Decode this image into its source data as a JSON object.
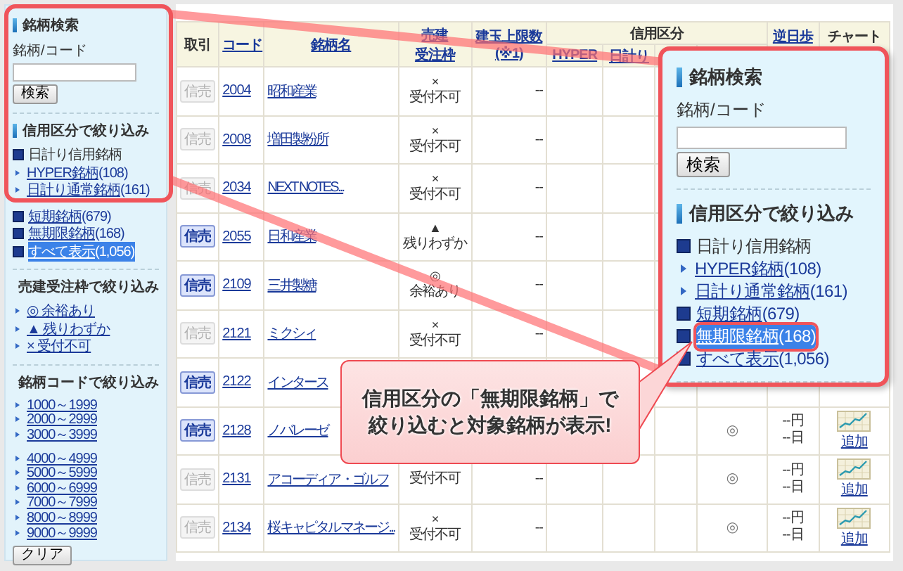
{
  "sidebar": {
    "search": {
      "title": "銘柄検索",
      "label": "銘柄/コード",
      "button": "検索"
    },
    "credit_filter": {
      "title": "信用区分で絞り込み",
      "items": [
        {
          "kind": "group",
          "label": "日計り信用銘柄",
          "children": [
            {
              "kind": "link",
              "label": "HYPER銘柄",
              "count": "(108)",
              "selected": false
            },
            {
              "kind": "link",
              "label": "日計り通常銘柄",
              "count": "(161)",
              "selected": false
            }
          ]
        },
        {
          "kind": "link",
          "label": "短期銘柄",
          "count": "(679)",
          "selected": false
        },
        {
          "kind": "link",
          "label": "無期限銘柄",
          "count": "(168)",
          "selected": false
        },
        {
          "kind": "link",
          "label": "すべて表示",
          "count": "(1,056)",
          "selected": true
        }
      ]
    },
    "margin_filter": {
      "title": "売建受注枠で絞り込み",
      "items": [
        "◎ 余裕あり",
        "▲ 残りわずか",
        "× 受付不可"
      ]
    },
    "code_filter": {
      "title": "銘柄コードで絞り込み",
      "items": [
        "1000～1999",
        "2000～2999",
        "3000～3999",
        "4000～4999",
        "5000～5999",
        "6000～6999",
        "7000～7999",
        "8000～8999",
        "9000～9999"
      ]
    },
    "clear_button": "クリア"
  },
  "table": {
    "header": [
      {
        "lines": [
          "取引"
        ],
        "link": false
      },
      {
        "lines": [
          "コード"
        ],
        "link": true
      },
      {
        "lines": [
          "銘柄名"
        ],
        "link": true
      },
      {
        "lines": [
          "売建",
          "受注枠"
        ],
        "link": true
      },
      {
        "lines": [
          "建玉上限数",
          "(※1)"
        ],
        "link": true
      },
      {
        "group": "信用区分",
        "subs": [
          "HYPER",
          "日計り"
        ]
      },
      {
        "lines": [
          "逆日歩"
        ],
        "link": true
      },
      {
        "lines": [
          "チャート"
        ],
        "link": false
      }
    ],
    "rows": [
      {
        "trade": "信売",
        "enabled": false,
        "code": "2004",
        "name": "昭和産業",
        "mark": "×",
        "status": "受付不可",
        "limit": "--"
      },
      {
        "trade": "信売",
        "enabled": false,
        "code": "2008",
        "name": "増田製粉所",
        "mark": "×",
        "status": "受付不可",
        "limit": "--"
      },
      {
        "trade": "信売",
        "enabled": false,
        "code": "2034",
        "name": "NEXT NOTES...",
        "mark": "×",
        "status": "受付不可",
        "limit": "--"
      },
      {
        "trade": "信売",
        "enabled": true,
        "code": "2055",
        "name": "日和産業",
        "mark": "▲",
        "status": "残りわずか",
        "limit": "--"
      },
      {
        "trade": "信売",
        "enabled": true,
        "code": "2109",
        "name": "三井製糖",
        "mark": "◎",
        "status": "余裕あり",
        "limit": "--"
      },
      {
        "trade": "信売",
        "enabled": false,
        "code": "2121",
        "name": "ミクシィ",
        "mark": "×",
        "status": "受付不可",
        "limit": "--"
      },
      {
        "trade": "信売",
        "enabled": true,
        "code": "2122",
        "name": "インタース"
      },
      {
        "trade": "信売",
        "enabled": true,
        "code": "2128",
        "name": "ノバレーゼ",
        "unlimited": "◎",
        "reverse": [
          "--円",
          "--日"
        ],
        "chart": "追加"
      },
      {
        "trade": "信売",
        "enabled": false,
        "code": "2131",
        "name": "アコーディア・ゴルフ",
        "status": "受付不可",
        "limit": "--",
        "unlimited": "◎",
        "reverse": [
          "--円",
          "--日"
        ],
        "chart": "追加"
      },
      {
        "trade": "信売",
        "enabled": false,
        "code": "2134",
        "name": "桜キャピタルマネージ...",
        "mark": "×",
        "status": "受付不可",
        "limit": "--",
        "unlimited": "◎",
        "reverse": [
          "--円",
          "--日"
        ],
        "chart": "追加"
      }
    ]
  },
  "zoom_panel": {
    "search": {
      "title": "銘柄検索",
      "label": "銘柄/コード",
      "button": "検索"
    },
    "credit_filter": {
      "title": "信用区分で絞り込み",
      "items": [
        {
          "kind": "group",
          "label": "日計り信用銘柄",
          "children": [
            {
              "kind": "link",
              "label": "HYPER銘柄",
              "count": "(108)",
              "selected": false
            },
            {
              "kind": "link",
              "label": "日計り通常銘柄",
              "count": "(161)",
              "selected": false
            }
          ]
        },
        {
          "kind": "link",
          "label": "短期銘柄",
          "count": "(679)",
          "selected": false
        },
        {
          "kind": "link",
          "label": "無期限銘柄",
          "count": "(168)",
          "selected": true
        },
        {
          "kind": "link",
          "label": "すべて表示",
          "count": "(1,056)",
          "selected": false
        }
      ]
    }
  },
  "callout": {
    "lines": [
      "信用区分の「無期限銘柄」で",
      "絞り込むと対象銘柄が表示!"
    ]
  }
}
